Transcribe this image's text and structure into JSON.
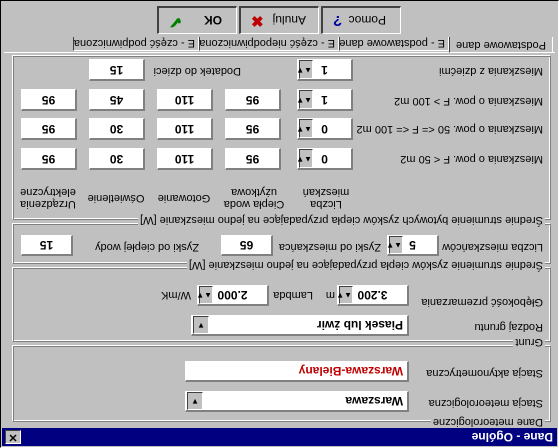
{
  "window": {
    "title": "Dane - Ogólne",
    "close_glyph": "✕"
  },
  "dane_meteo": {
    "group_label": "Dane meteorologiczne",
    "stacja_meteo_label": "Stacja meteorologiczna",
    "stacja_meteo_value": "Warszawa",
    "stacja_akt_label": "Stacja aktynometryczna",
    "stacja_akt_value": "Warszawa-Bielany"
  },
  "grunt": {
    "group_label": "Grunt",
    "rodzaj_label": "Rodzaj gruntu",
    "rodzaj_value": "Piasek lub żwir",
    "glebokosc_label": "Głębokość przemarzania",
    "glebokosc_value": "3.200",
    "glebokosc_unit": "m",
    "lambda_label": "Lambda",
    "lambda_value": "2.000",
    "lambda_unit": "W/mK"
  },
  "zyski_przeciętne": {
    "group_label": "Średnie strumienie zysków ciepła przypadające na jedno mieszkanie [W]",
    "liczba_label": "Liczba mieszkańców",
    "liczba_value": "5",
    "zyski_mieszk_label": "Zyski od mieszkańca",
    "zyski_mieszk_value": "65",
    "zyski_cw_label": "Zyski od ciepłej wody",
    "zyski_cw_value": "15"
  },
  "zyski_bytowe": {
    "group_label": "Średnie strumienie bytowych zysków ciepła przypadające na jedno mieszkanie [W]",
    "headers": [
      "Liczba mieszkań",
      "Ciepła woda użytkowa",
      "Gotowanie",
      "Oświetlenie",
      "Urządzenia elektryczne"
    ],
    "rows": [
      {
        "label": "Mieszkania o pow. F < 50 m2",
        "count": "0",
        "values": [
          "95",
          "110",
          "30",
          "95"
        ]
      },
      {
        "label": "Mieszkania o pow. 50 <= F <= 100 m2",
        "count": "0",
        "values": [
          "95",
          "110",
          "30",
          "95"
        ]
      },
      {
        "label": "Mieszkania o pow. F > 100 m2",
        "count": "1",
        "values": [
          "95",
          "110",
          "45",
          "95"
        ]
      }
    ],
    "dzieci_label": "Mieszkania z dziećmi",
    "dzieci_value": "1",
    "dodatek_label": "Dodatek do dzieci",
    "dodatek_value": "15"
  },
  "tabs": [
    {
      "label": "Podstawowe dane"
    },
    {
      "label": "E - podstawowe dane"
    },
    {
      "label": "E - część niepodpiwniczona"
    },
    {
      "label": "E - część podpiwniczona"
    }
  ],
  "buttons": {
    "ok": "OK",
    "anuluj": "Anuluj",
    "pomoc": "Pomoc"
  },
  "colors": {
    "title_bar": "#000080",
    "window_bg": "#c0c0c0",
    "red_text": "#c00000"
  }
}
